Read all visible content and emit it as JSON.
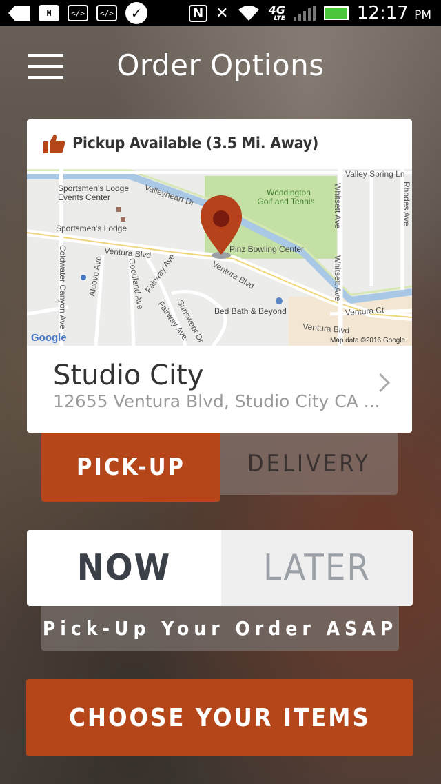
{
  "status_bar": {
    "time": "12:17",
    "ampm": "PM",
    "network": "4G",
    "network_sub": "LTE",
    "code_icon_text": "</>"
  },
  "header": {
    "title": "Order Options"
  },
  "location_card": {
    "pickup_status": "Pickup Available (3.5 Mi. Away)",
    "store_name": "Studio City",
    "store_address": "12655 Ventura Blvd, Studio City CA ...",
    "map_labels": {
      "valley_spring": "Valley Spring Ln",
      "valleyheart": "Valleyheart Dr",
      "weddington_1": "Weddington",
      "weddington_2": "Golf and Tennis",
      "sportsmens_lodge_events_1": "Sportsmen's Lodge",
      "sportsmens_lodge_events_2": "Events Center",
      "sportsmens_lodge": "Sportsmen's Lodge",
      "ventura_blvd_1": "Ventura Blvd",
      "ventura_blvd_2": "Ventura Blvd",
      "ventura_blvd_3": "Ventura Blvd",
      "pinz": "Pinz Bowling Center",
      "whitsett_1": "Whitsett Ave",
      "whitsett_2": "Whitsett Ave",
      "rhodes": "Rhodes Ave",
      "coldwater": "Coldwater Canyon Ave",
      "alcove": "Alcove Ave",
      "goodland": "Goodland Ave",
      "fairway_1": "Fairway Ave",
      "fairway_2": "Fairway Ave",
      "sunswept": "Sunswept Dr",
      "bed_bath": "Bed Bath & Beyond",
      "ventura_ct": "Ventura Ct",
      "google": "Google",
      "map_data": "Map data ©2016 Google"
    }
  },
  "order_type_tabs": {
    "pickup_label": "PICK-UP",
    "delivery_label": "DELIVERY",
    "selected": "PICK-UP"
  },
  "timing_tabs": {
    "now_label": "NOW",
    "later_label": "LATER",
    "selected": "NOW"
  },
  "timing_note": "Pick-Up Your Order ASAP",
  "cta": {
    "label": "CHOOSE YOUR ITEMS"
  },
  "colors": {
    "accent": "#b5461a",
    "pin": "#b5421b"
  },
  "icons": {
    "menu": "hamburger-icon",
    "thumbs_up": "thumbs-up-icon",
    "map_pin": "map-pin-icon",
    "chevron": "chevron-right-icon"
  }
}
